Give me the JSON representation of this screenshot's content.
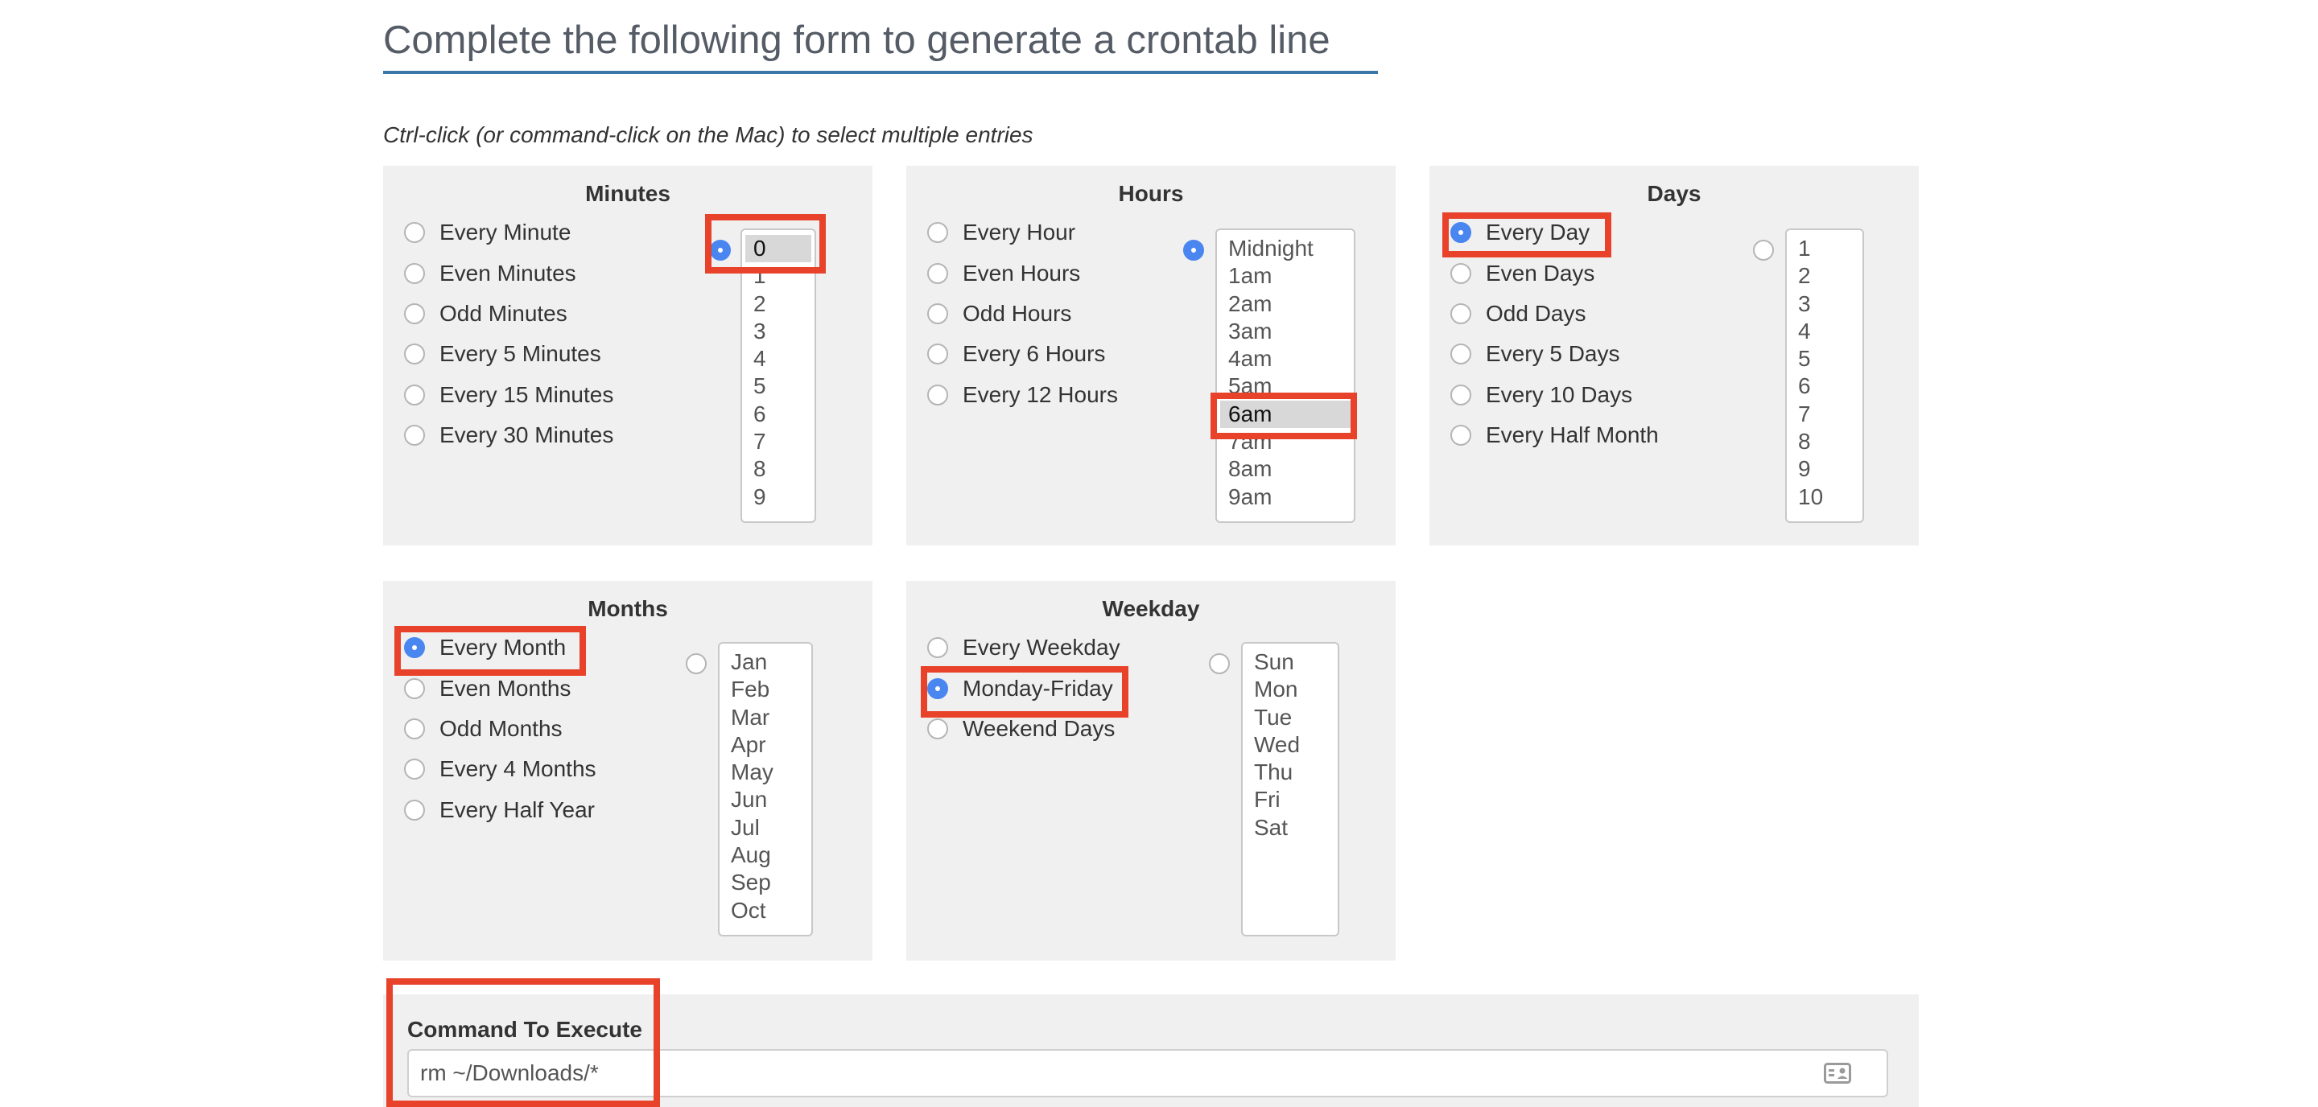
{
  "page": {
    "title": "Complete the following form to generate a crontab line",
    "instructions": "Ctrl-click (or command-click on the Mac) to select multiple entries"
  },
  "minutes": {
    "title": "Minutes",
    "options": [
      "Every Minute",
      "Even Minutes",
      "Odd Minutes",
      "Every 5 Minutes",
      "Every 15 Minutes",
      "Every 30 Minutes"
    ],
    "list": [
      "0",
      "1",
      "2",
      "3",
      "4",
      "5",
      "6",
      "7",
      "8",
      "9"
    ],
    "selected_mode": "list",
    "selected_values": [
      "0"
    ]
  },
  "hours": {
    "title": "Hours",
    "options": [
      "Every Hour",
      "Even Hours",
      "Odd Hours",
      "Every 6 Hours",
      "Every 12 Hours"
    ],
    "list": [
      "Midnight",
      "1am",
      "2am",
      "3am",
      "4am",
      "5am",
      "6am",
      "7am",
      "8am",
      "9am"
    ],
    "selected_mode": "list",
    "selected_values": [
      "6am"
    ]
  },
  "days": {
    "title": "Days",
    "options": [
      "Every Day",
      "Even Days",
      "Odd Days",
      "Every 5 Days",
      "Every 10 Days",
      "Every Half Month"
    ],
    "list": [
      "1",
      "2",
      "3",
      "4",
      "5",
      "6",
      "7",
      "8",
      "9",
      "10"
    ],
    "selected_mode": "Every Day",
    "selected_values": []
  },
  "months": {
    "title": "Months",
    "options": [
      "Every Month",
      "Even Months",
      "Odd Months",
      "Every 4 Months",
      "Every Half Year"
    ],
    "list": [
      "Jan",
      "Feb",
      "Mar",
      "Apr",
      "May",
      "Jun",
      "Jul",
      "Aug",
      "Sep",
      "Oct"
    ],
    "selected_mode": "Every Month",
    "selected_values": []
  },
  "weekday": {
    "title": "Weekday",
    "options": [
      "Every Weekday",
      "Monday-Friday",
      "Weekend Days"
    ],
    "list": [
      "Sun",
      "Mon",
      "Tue",
      "Wed",
      "Thu",
      "Fri",
      "Sat"
    ],
    "selected_mode": "Monday-Friday",
    "selected_values": []
  },
  "command": {
    "label": "Command To Execute",
    "value": "rm ~/Downloads/*"
  },
  "colors": {
    "highlight": "#e8422a",
    "radio_checked": "#4a86f0",
    "panel_bg": "#f0f0f0",
    "title_underline": "#3b78a8"
  },
  "icons": {
    "command_field": "contact-card-icon"
  }
}
